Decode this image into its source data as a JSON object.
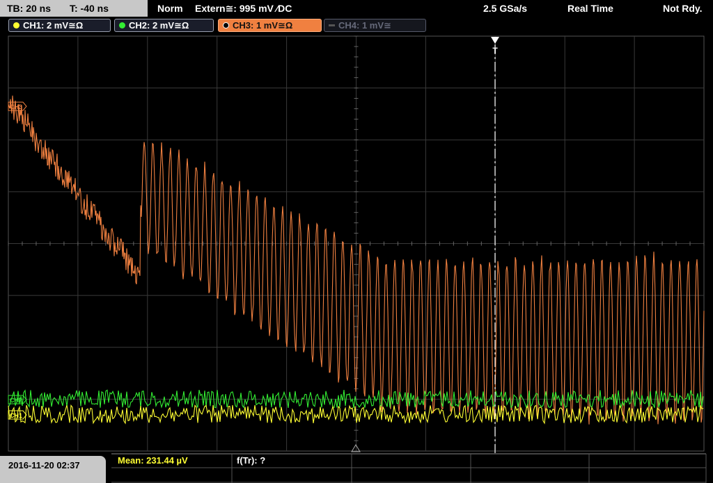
{
  "topbar": {
    "timebase": "TB: 20 ns",
    "trigger_time": "T: -40 ns",
    "trigger_mode": "Norm",
    "trigger_source": "Extern≅: 995 mV ∕DC",
    "sample_rate": "2.5 GSa/s",
    "acq_mode": "Real Time",
    "status": "Not Rdy."
  },
  "channels": [
    {
      "label": "CH1: 2 mV≅Ω",
      "color": "#ffff33",
      "active": true
    },
    {
      "label": "CH2: 2 mV≅Ω",
      "color": "#33ee33",
      "active": true
    },
    {
      "label": "CH3: 1 mV≅Ω",
      "color": "#f08040",
      "active": true,
      "selected": true
    },
    {
      "label": "CH4: 1 mV≅",
      "color": "#666a7a",
      "active": false
    }
  ],
  "markers": {
    "trigger_marker": "T",
    "ch3_ref": "CH3",
    "ch2_ref": "CH2",
    "ch1_ref": "CH1"
  },
  "bottombar": {
    "datetime": "2016-11-20 02:37",
    "mean_label": "Mean: 231.44 µV",
    "freq_label": "f(Tr): ?"
  },
  "colors": {
    "ch1": "#ffff33",
    "ch2": "#33ee33",
    "ch3": "#f08040",
    "grid": "#3a3a3a",
    "trigger_line": "#ffffff"
  }
}
